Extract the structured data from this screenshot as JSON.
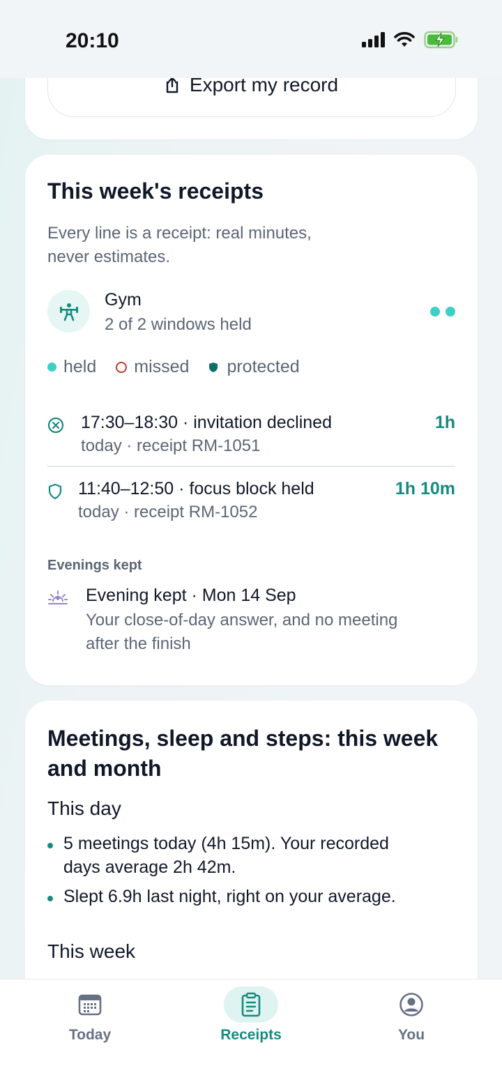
{
  "status_bar": {
    "time": "20:10"
  },
  "export": {
    "label": "Export my record"
  },
  "receipts": {
    "title": "This week's receipts",
    "subtitle_line1": "Every line is a receipt: real minutes,",
    "subtitle_line2": "never estimates.",
    "habit": {
      "name": "Gym",
      "status": "2 of 2 windows held",
      "icon": "weightlifter-icon"
    },
    "legend": {
      "held": "held",
      "missed": "missed",
      "protected": "protected"
    },
    "rows": [
      {
        "title": "17:30–18:30 · invitation declined",
        "sub": "today · receipt RM-1051",
        "duration": "1h",
        "icon": "circle-x-icon"
      },
      {
        "title": "11:40–12:50 · focus block held",
        "sub": "today · receipt RM-1052",
        "duration": "1h 10m",
        "icon": "shield-icon"
      }
    ],
    "evenings": {
      "heading": "Evenings kept",
      "title": "Evening kept · Mon 14 Sep",
      "desc_line1": "Your close-of-day answer, and no meeting",
      "desc_line2": "after the finish",
      "icon": "sunset-icon"
    }
  },
  "meetings": {
    "title_line1": "Meetings, sleep and steps: this week",
    "title_line2": "and month",
    "day_heading": "This day",
    "bullets": [
      {
        "line1": "5 meetings today (4h 15m). Your recorded",
        "line2": "days average 2h 42m."
      },
      {
        "line1": "Slept 6.9h last night, right on your average.",
        "line2": ""
      }
    ],
    "week_heading": "This week"
  },
  "tabs": [
    {
      "label": "Today",
      "icon": "calendar-icon",
      "active": false
    },
    {
      "label": "Receipts",
      "icon": "clipboard-icon",
      "active": true
    },
    {
      "label": "You",
      "icon": "user-circle-icon",
      "active": false
    }
  ],
  "colors": {
    "accent": "#178a80",
    "held": "#3ecfc4",
    "missed": "#c0392b",
    "protected": "#0f6e66",
    "evening": "#9a83c9"
  }
}
